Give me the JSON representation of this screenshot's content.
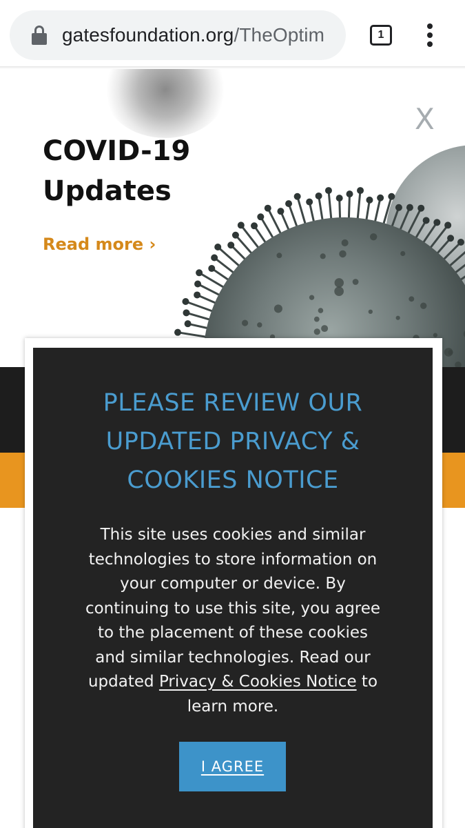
{
  "browser": {
    "url_host": "gatesfoundation.org",
    "url_path": "/TheOptim",
    "tab_count": "1",
    "icons": [
      "lock-icon",
      "tab-switcher-icon",
      "more-vert-icon"
    ]
  },
  "hero": {
    "title_line1": "COVID-19",
    "title_line2": "Updates",
    "read_more": "Read more ›",
    "close_label": "X"
  },
  "cookie_modal": {
    "title_line1": "PLEASE REVIEW OUR",
    "title_line2": "UPDATED PRIVACY &",
    "title_line3": "COOKIES NOTICE",
    "body_lines": [
      "This site uses cookies and similar",
      "technologies to store information on",
      "your computer or device. By",
      "continuing to use this site, you agree",
      "to the placement of these cookies",
      "and similar technologies. Read our"
    ],
    "body_pre_link": "updated ",
    "link_text": "Privacy & Cookies Notice",
    "body_post_link": " to",
    "body_last_line": "learn more.",
    "agree_button": "I AGREE"
  },
  "colors": {
    "accent_orange": "#d5891b",
    "modal_title_blue": "#4a9ccf",
    "button_blue": "#3d93c9",
    "modal_bg": "#232323"
  }
}
